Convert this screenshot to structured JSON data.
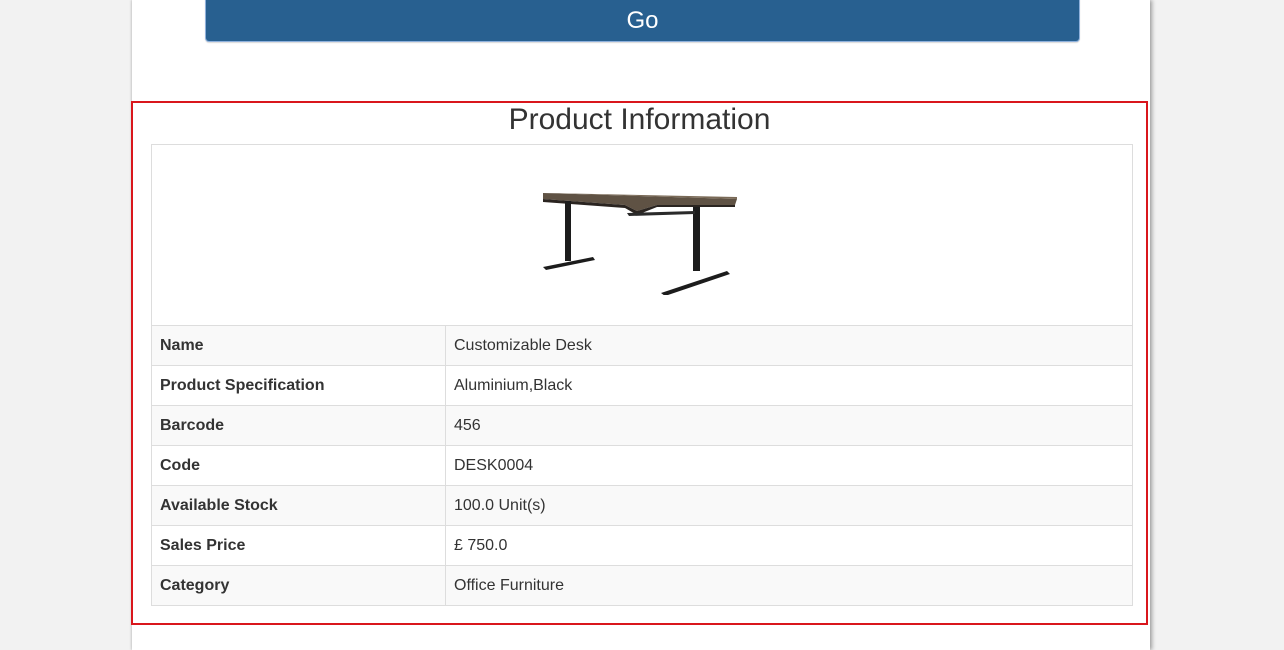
{
  "colors": {
    "button_bg": "#286090",
    "section_border": "#d9161c",
    "table_border": "#dddddd",
    "stripe": "#f9f9f9"
  },
  "toolbar": {
    "go_label": "Go"
  },
  "product": {
    "title": "Product Information",
    "image_icon": "desk-image",
    "rows": [
      {
        "label": "Name",
        "value": "Customizable Desk"
      },
      {
        "label": "Product Specification",
        "value": "Aluminium,Black"
      },
      {
        "label": "Barcode",
        "value": "456"
      },
      {
        "label": "Code",
        "value": "DESK0004"
      },
      {
        "label": "Available Stock",
        "value": "100.0 Unit(s)"
      },
      {
        "label": "Sales Price",
        "value": "£ 750.0"
      },
      {
        "label": "Category",
        "value": "Office Furniture"
      }
    ]
  }
}
